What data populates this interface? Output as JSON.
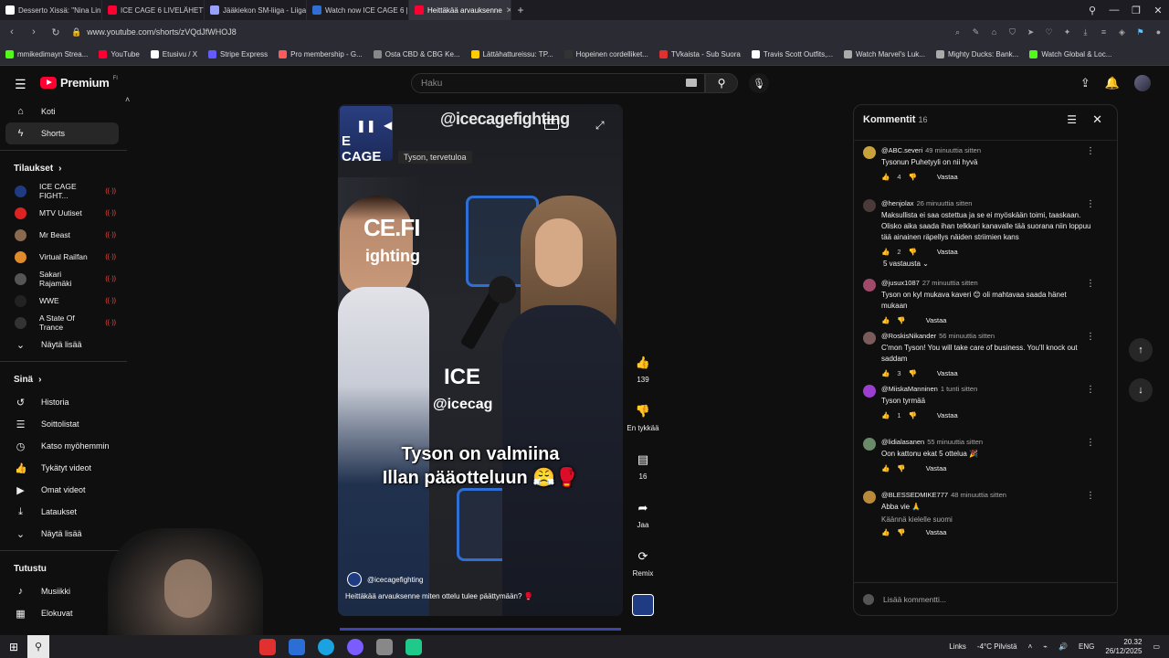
{
  "browser": {
    "tabs": [
      {
        "label": "Desserto Xissä: \"Nina Lin c",
        "color": "#ffffff",
        "active": false
      },
      {
        "label": "ICE CAGE 6 LIVELÄHETYS",
        "color": "#ff0033",
        "active": false
      },
      {
        "label": "Jääkiekon SM-liiga - Liiga",
        "color": "#9aa0ff",
        "active": false
      },
      {
        "label": "Watch now ICE CAGE 6 | L",
        "color": "#2f6fd3",
        "active": false
      },
      {
        "label": "Heittäkää arvauksenne",
        "color": "#ff0033",
        "active": true
      }
    ],
    "url": "www.youtube.com/shorts/zVQdJfWHOJ8",
    "bookmarks": [
      {
        "label": "mmikedimayn Strea...",
        "color": "#53fc18"
      },
      {
        "label": "YouTube",
        "color": "#ff0033"
      },
      {
        "label": "Etusivu / X",
        "color": "#ffffff"
      },
      {
        "label": "Stripe Express",
        "color": "#635bff"
      },
      {
        "label": "Pro membership - G...",
        "color": "#ff5a5a"
      },
      {
        "label": "Osta CBD & CBG Ke...",
        "color": "#888888"
      },
      {
        "label": "Lättähattureissu: TP...",
        "color": "#ffcc00"
      },
      {
        "label": "Hopeinen cordelliket...",
        "color": "#333333"
      },
      {
        "label": "TVkaista - Sub Suora",
        "color": "#e03030"
      },
      {
        "label": "Travis Scott Outfits,...",
        "color": "#ffffff"
      },
      {
        "label": "Watch Marvel's Luk...",
        "color": "#aaaaaa"
      },
      {
        "label": "Mighty Ducks: Bank...",
        "color": "#aaaaaa"
      },
      {
        "label": "Watch Global & Loc...",
        "color": "#53fc18"
      }
    ]
  },
  "header": {
    "logo_text": "Premium",
    "logo_suffix": "FI",
    "search_placeholder": "Haku"
  },
  "sidebar": {
    "main": [
      {
        "label": "Koti",
        "icon": "home-icon",
        "glyph": "⌂"
      },
      {
        "label": "Shorts",
        "icon": "shorts-icon",
        "glyph": "ϟ"
      }
    ],
    "subs_title": "Tilaukset",
    "subs": [
      {
        "label": "ICE CAGE FIGHT...",
        "color": "#1f3b84",
        "live": "((·))"
      },
      {
        "label": "MTV Uutiset",
        "color": "#d22",
        "live": "((·))"
      },
      {
        "label": "Mr Beast",
        "color": "#8a6a4e",
        "live": "((·))"
      },
      {
        "label": "Virtual Railfan",
        "color": "#e08a2a",
        "live": "((·))"
      },
      {
        "label": "Sakari Rajamäki",
        "color": "#555",
        "live": "((·))"
      },
      {
        "label": "WWE",
        "color": "#222",
        "live": "((·))"
      },
      {
        "label": "A State Of Trance",
        "color": "#333",
        "live": "((·))"
      }
    ],
    "show_more": "Näytä lisää",
    "you_title": "Sinä",
    "you": [
      {
        "label": "Historia",
        "icon": "history-icon",
        "glyph": "↺"
      },
      {
        "label": "Soittolistat",
        "icon": "playlists-icon",
        "glyph": "☰"
      },
      {
        "label": "Katso myöhemmin",
        "icon": "watch-later-icon",
        "glyph": "◷"
      },
      {
        "label": "Tykätyt videot",
        "icon": "liked-icon",
        "glyph": "👍"
      },
      {
        "label": "Omat videot",
        "icon": "my-videos-icon",
        "glyph": "▶"
      },
      {
        "label": "Lataukset",
        "icon": "downloads-icon",
        "glyph": "⤓"
      }
    ],
    "show_more_2": "Näytä lisää",
    "explore_title": "Tutustu",
    "explore": [
      {
        "label": "Musiikki",
        "icon": "music-icon",
        "glyph": "♪"
      },
      {
        "label": "Elokuvat",
        "icon": "movies-icon",
        "glyph": "▦"
      }
    ]
  },
  "video": {
    "watermark": "@icecagefighting",
    "tooltip": "Tyson, tervetuloa",
    "brand_left_1": "CE.FI",
    "brand_left_2": "ighting",
    "brand_mid_1": "ICE",
    "brand_mid_2": "@icecag",
    "badge_text": "E CAGE",
    "caption_line1": "Tyson on valmiina",
    "caption_line2": "Illan pääotteluun 😤🥊",
    "channel": "@icecagefighting",
    "title": "Heittäkää arvauksenne miten ottelu tulee päättymään? 🥊"
  },
  "actions": {
    "like_count": "139",
    "dislike_label": "En tykkää",
    "comment_count": "16",
    "share_label": "Jaa",
    "remix_label": "Remix"
  },
  "comments": {
    "title": "Kommentit",
    "count": "16",
    "reply_label": "Vastaa",
    "add_placeholder": "Lisää kommentti...",
    "items": [
      {
        "author": "@ABC.severi",
        "time": "49 minuuttia sitten",
        "text": "Tysonun Puhetyyli on nii hyvä",
        "likes": "4",
        "color": "#c8a23a"
      },
      {
        "author": "@henjolax",
        "time": "26 minuuttia sitten",
        "text": "Maksullista ei saa ostettua ja se ei myöskään toimi, taaskaan. Olisko aika saada ihan telkkari kanavalle tää suorana niin loppuu tää ainainen räpellys näiden striimien kans",
        "likes": "2",
        "color": "#4a3a3a",
        "replies": "5 vastausta"
      },
      {
        "author": "@jusux1087",
        "time": "27 minuuttia sitten",
        "text": "Tyson on kyl mukava kaveri 😊 oli mahtavaa saada hänet mukaan",
        "likes": "",
        "color": "#a04a6a"
      },
      {
        "author": "@RoskisNikander",
        "time": "56 minuuttia sitten",
        "text": "C'mon Tyson! You will take care of business. You'll knock out saddam",
        "likes": "3",
        "color": "#7a5a5a"
      },
      {
        "author": "@MiiskaManninen",
        "time": "1 tunti sitten",
        "text": "Tyson tyrmää",
        "likes": "1",
        "color": "#9c3fd0"
      },
      {
        "author": "@lidialasanen",
        "time": "55 minuuttia sitten",
        "text": "Oon kattonu ekat 5 ottelua 🎉",
        "likes": "",
        "color": "#6a8a6a"
      },
      {
        "author": "@BLESSEDMIKE777",
        "time": "48 minuuttia sitten",
        "text": "Abba vie 🙏",
        "translate": "Käännä kielelle suomi",
        "likes": "",
        "color": "#b88a3a"
      }
    ]
  },
  "taskbar": {
    "links_label": "Links",
    "weather": "-4°C Pilvistä",
    "lang": "ENG",
    "time": "20.32",
    "date": "26/12/2025"
  }
}
